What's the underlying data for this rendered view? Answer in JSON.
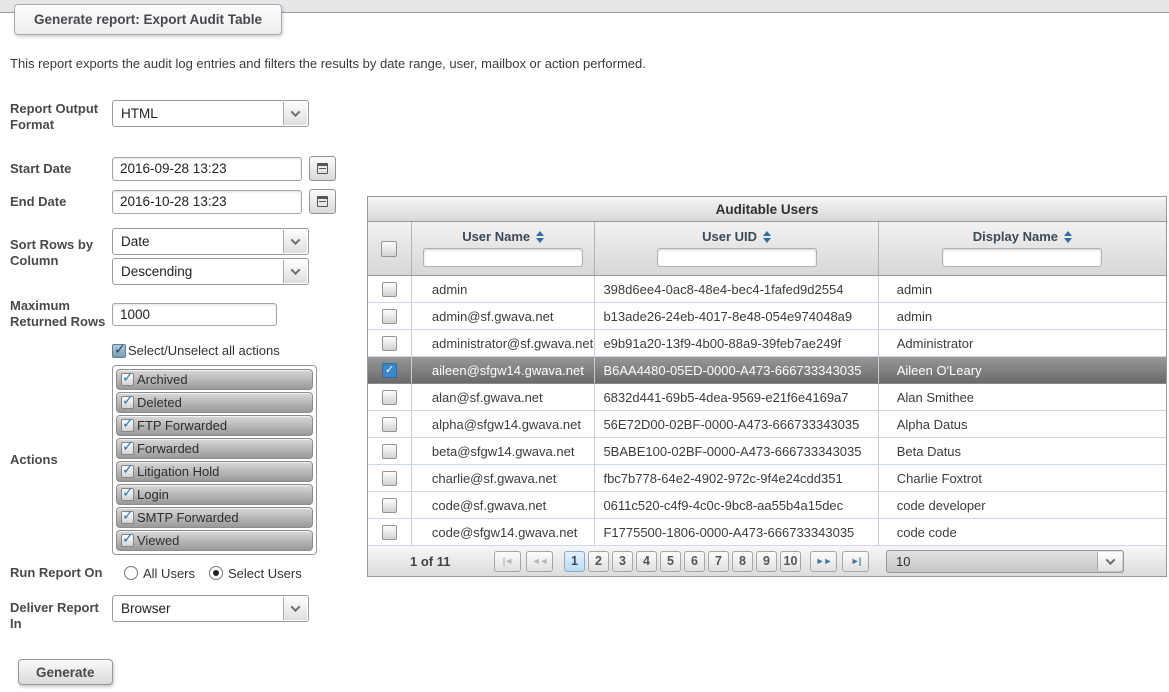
{
  "tab": {
    "title": "Generate report: Export Audit Table"
  },
  "description": "This report exports the audit log entries and filters the results by date range, user, mailbox or action performed.",
  "icons": {
    "check": "✓",
    "pager_first": "|◄",
    "pager_prev": "◄◄",
    "pager_next": "►►",
    "pager_last": "►|"
  },
  "colors": {
    "accent_check_blue": "#2a7ab8",
    "selected_row_gray": "#7a7a7a",
    "active_page_blue": "#cde1f3",
    "header_text_navy": "#3c4a59"
  },
  "form": {
    "report_output_format": {
      "label": "Report Output Format",
      "value": "HTML"
    },
    "start_date": {
      "label": "Start Date",
      "value": "2016-09-28 13:23"
    },
    "end_date": {
      "label": "End Date",
      "value": "2016-10-28 13:23"
    },
    "sort_rows": {
      "label": "Sort Rows by Column",
      "column_value": "Date",
      "direction_value": "Descending"
    },
    "max_rows": {
      "label": "Maximum Returned Rows",
      "value": "1000"
    },
    "select_all_actions": {
      "label": "Select/Unselect all actions",
      "checked": true
    },
    "actions": {
      "label": "Actions",
      "items": [
        {
          "label": "Archived",
          "checked": true
        },
        {
          "label": "Deleted",
          "checked": true
        },
        {
          "label": "FTP Forwarded",
          "checked": true
        },
        {
          "label": "Forwarded",
          "checked": true
        },
        {
          "label": "Litigation Hold",
          "checked": true
        },
        {
          "label": "Login",
          "checked": true
        },
        {
          "label": "SMTP Forwarded",
          "checked": true
        },
        {
          "label": "Viewed",
          "checked": true
        }
      ]
    },
    "run_report_on": {
      "label": "Run Report On",
      "options": [
        {
          "label": "All Users",
          "selected": false
        },
        {
          "label": "Select Users",
          "selected": true
        }
      ]
    },
    "deliver_report_in": {
      "label": "Deliver Report In",
      "value": "Browser"
    },
    "generate_label": "Generate"
  },
  "table": {
    "title": "Auditable Users",
    "columns": {
      "user_name": "User Name",
      "user_uid": "User UID",
      "display_name": "Display Name"
    },
    "rows": [
      {
        "user_name": "admin",
        "user_uid": "398d6ee4-0ac8-48e4-bec4-1fafed9d2554",
        "display_name": "admin",
        "checked": false,
        "selected": false
      },
      {
        "user_name": "admin@sf.gwava.net",
        "user_uid": "b13ade26-24eb-4017-8e48-054e974048a9",
        "display_name": "admin",
        "checked": false,
        "selected": false
      },
      {
        "user_name": "administrator@sf.gwava.net",
        "user_uid": "e9b91a20-13f9-4b00-88a9-39feb7ae249f",
        "display_name": "Administrator",
        "checked": false,
        "selected": false
      },
      {
        "user_name": "aileen@sfgw14.gwava.net",
        "user_uid": "B6AA4480-05ED-0000-A473-666733343035",
        "display_name": "Aileen O'Leary",
        "checked": true,
        "selected": true
      },
      {
        "user_name": "alan@sf.gwava.net",
        "user_uid": "6832d441-69b5-4dea-9569-e21f6e4169a7",
        "display_name": "Alan Smithee",
        "checked": false,
        "selected": false
      },
      {
        "user_name": "alpha@sfgw14.gwava.net",
        "user_uid": "56E72D00-02BF-0000-A473-666733343035",
        "display_name": "Alpha Datus",
        "checked": false,
        "selected": false
      },
      {
        "user_name": "beta@sfgw14.gwava.net",
        "user_uid": "5BABE100-02BF-0000-A473-666733343035",
        "display_name": "Beta Datus",
        "checked": false,
        "selected": false
      },
      {
        "user_name": "charlie@sf.gwava.net",
        "user_uid": "fbc7b778-64e2-4902-972c-9f4e24cdd351",
        "display_name": "Charlie Foxtrot",
        "checked": false,
        "selected": false
      },
      {
        "user_name": "code@sf.gwava.net",
        "user_uid": "0611c520-c4f9-4c0c-9bc8-aa55b4a15dec",
        "display_name": "code developer",
        "checked": false,
        "selected": false
      },
      {
        "user_name": "code@sfgw14.gwava.net",
        "user_uid": "F1775500-1806-0000-A473-666733343035",
        "display_name": "code code",
        "checked": false,
        "selected": false
      }
    ],
    "pagination": {
      "status": "1 of 11",
      "pages": [
        "1",
        "2",
        "3",
        "4",
        "5",
        "6",
        "7",
        "8",
        "9",
        "10"
      ],
      "active_page": "1",
      "page_size": "10",
      "nav": {
        "first": {
          "enabled": false
        },
        "prev": {
          "enabled": false
        },
        "next": {
          "enabled": true
        },
        "last": {
          "enabled": true
        }
      }
    }
  }
}
